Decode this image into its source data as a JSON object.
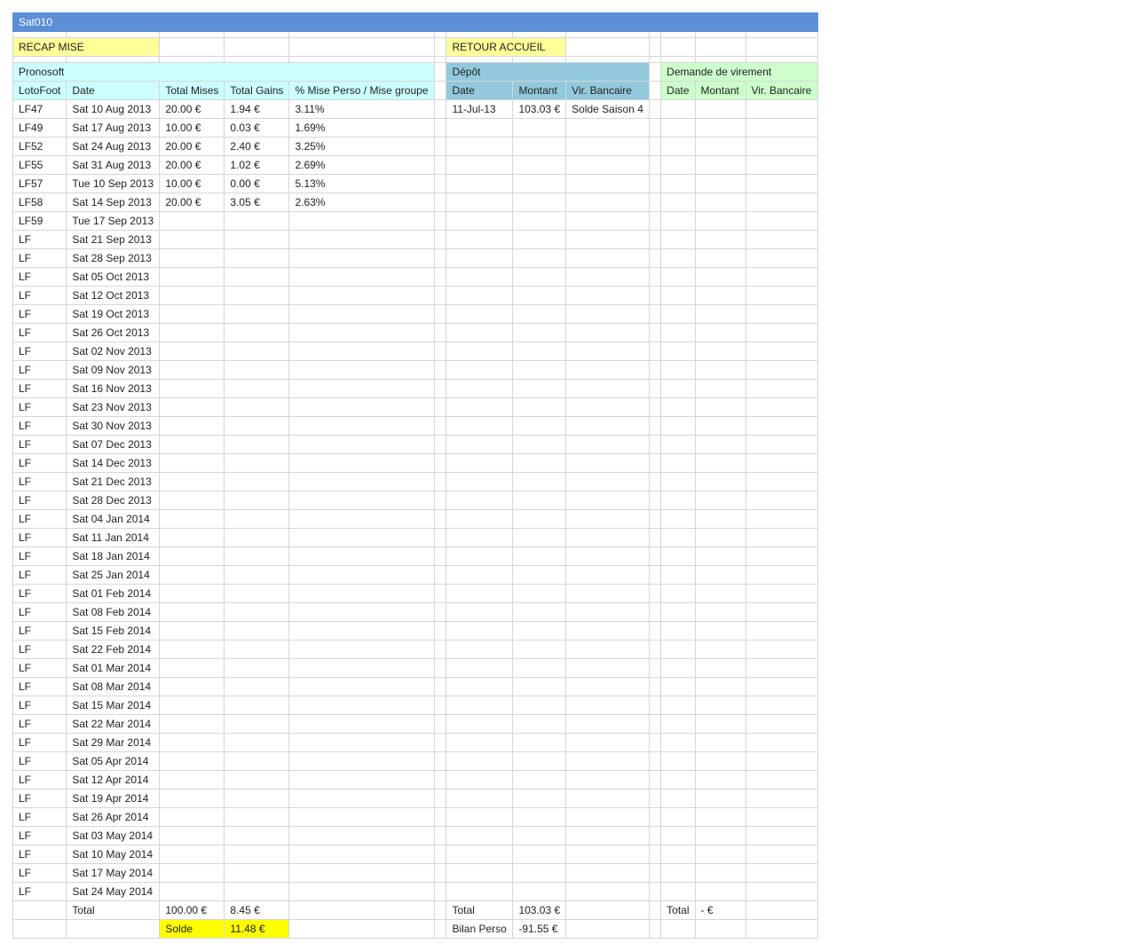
{
  "sheet_title": "Sat010",
  "nav": {
    "recap_mise": "RECAP MISE",
    "retour_accueil": "RETOUR ACCUEIL"
  },
  "pronosoft": {
    "title": "Pronosoft",
    "headers": [
      "LotoFoot",
      "Date",
      "Total Mises",
      "Total Gains",
      "% Mise Perso / Mise groupe"
    ],
    "rows": [
      [
        "LF47",
        "Sat 10 Aug 2013",
        "20.00 €",
        "1.94 €",
        "3.11%"
      ],
      [
        "LF49",
        "Sat 17 Aug 2013",
        "10.00 €",
        "0.03 €",
        "1.69%"
      ],
      [
        "LF52",
        "Sat 24 Aug 2013",
        "20.00 €",
        "2.40 €",
        "3.25%"
      ],
      [
        "LF55",
        "Sat 31 Aug 2013",
        "20.00 €",
        "1.02 €",
        "2.69%"
      ],
      [
        "LF57",
        "Tue 10 Sep 2013",
        "10.00 €",
        "0.00 €",
        "5.13%"
      ],
      [
        "LF58",
        "Sat 14 Sep 2013",
        "20.00 €",
        "3.05 €",
        "2.63%"
      ],
      [
        "LF59",
        "Tue 17 Sep 2013",
        "",
        "",
        ""
      ],
      [
        "LF",
        "Sat 21 Sep 2013",
        "",
        "",
        ""
      ],
      [
        "LF",
        "Sat 28 Sep 2013",
        "",
        "",
        ""
      ],
      [
        "LF",
        "Sat 05 Oct 2013",
        "",
        "",
        ""
      ],
      [
        "LF",
        "Sat 12 Oct 2013",
        "",
        "",
        ""
      ],
      [
        "LF",
        "Sat 19 Oct 2013",
        "",
        "",
        ""
      ],
      [
        "LF",
        "Sat 26 Oct 2013",
        "",
        "",
        ""
      ],
      [
        "LF",
        "Sat 02 Nov 2013",
        "",
        "",
        ""
      ],
      [
        "LF",
        "Sat 09 Nov 2013",
        "",
        "",
        ""
      ],
      [
        "LF",
        "Sat 16 Nov 2013",
        "",
        "",
        ""
      ],
      [
        "LF",
        "Sat 23 Nov 2013",
        "",
        "",
        ""
      ],
      [
        "LF",
        "Sat 30 Nov 2013",
        "",
        "",
        ""
      ],
      [
        "LF",
        "Sat 07 Dec 2013",
        "",
        "",
        ""
      ],
      [
        "LF",
        "Sat 14 Dec 2013",
        "",
        "",
        ""
      ],
      [
        "LF",
        "Sat 21 Dec 2013",
        "",
        "",
        ""
      ],
      [
        "LF",
        "Sat 28 Dec 2013",
        "",
        "",
        ""
      ],
      [
        "LF",
        "Sat 04 Jan 2014",
        "",
        "",
        ""
      ],
      [
        "LF",
        "Sat 11 Jan 2014",
        "",
        "",
        ""
      ],
      [
        "LF",
        "Sat 18 Jan 2014",
        "",
        "",
        ""
      ],
      [
        "LF",
        "Sat 25 Jan 2014",
        "",
        "",
        ""
      ],
      [
        "LF",
        "Sat 01 Feb 2014",
        "",
        "",
        ""
      ],
      [
        "LF",
        "Sat 08 Feb 2014",
        "",
        "",
        ""
      ],
      [
        "LF",
        "Sat 15 Feb 2014",
        "",
        "",
        ""
      ],
      [
        "LF",
        "Sat 22 Feb 2014",
        "",
        "",
        ""
      ],
      [
        "LF",
        "Sat 01 Mar 2014",
        "",
        "",
        ""
      ],
      [
        "LF",
        "Sat 08 Mar 2014",
        "",
        "",
        ""
      ],
      [
        "LF",
        "Sat 15 Mar 2014",
        "",
        "",
        ""
      ],
      [
        "LF",
        "Sat 22 Mar 2014",
        "",
        "",
        ""
      ],
      [
        "LF",
        "Sat 29 Mar 2014",
        "",
        "",
        ""
      ],
      [
        "LF",
        "Sat 05 Apr 2014",
        "",
        "",
        ""
      ],
      [
        "LF",
        "Sat 12 Apr 2014",
        "",
        "",
        ""
      ],
      [
        "LF",
        "Sat 19 Apr 2014",
        "",
        "",
        ""
      ],
      [
        "LF",
        "Sat 26 Apr 2014",
        "",
        "",
        ""
      ],
      [
        "LF",
        "Sat 03 May 2014",
        "",
        "",
        ""
      ],
      [
        "LF",
        "Sat 10 May 2014",
        "",
        "",
        ""
      ],
      [
        "LF",
        "Sat 17 May 2014",
        "",
        "",
        ""
      ],
      [
        "LF",
        "Sat 24 May 2014",
        "",
        "",
        ""
      ]
    ],
    "total_label": "Total",
    "total_mises": "100.00 €",
    "total_gains": "8.45 €",
    "solde_label": "Solde",
    "solde_value": "11.48 €"
  },
  "depot": {
    "title": "Dépôt",
    "headers": [
      "Date",
      "Montant",
      "Vir. Bancaire"
    ],
    "rows": [
      [
        "11-Jul-13",
        "103.03 €",
        "Solde Saison 4"
      ]
    ],
    "total_label": "Total",
    "total_value": "103.03 €",
    "bilan_label": "Bilan Perso",
    "bilan_value": "-91.55 €"
  },
  "virement": {
    "title": "Demande de virement",
    "headers": [
      "Date",
      "Montant",
      "Vir. Bancaire"
    ],
    "rows": [],
    "total_label": "Total",
    "total_value": "- €"
  },
  "colors": {
    "title_bar": "#5b8fd6",
    "nav_yellow": "#ffff99",
    "solde_yellow": "#ffff00",
    "pronosoft_cyan": "#ccffff",
    "depot_blue": "#92c9dc",
    "virement_green": "#ccffcc",
    "grid": "#d6d6d6"
  }
}
